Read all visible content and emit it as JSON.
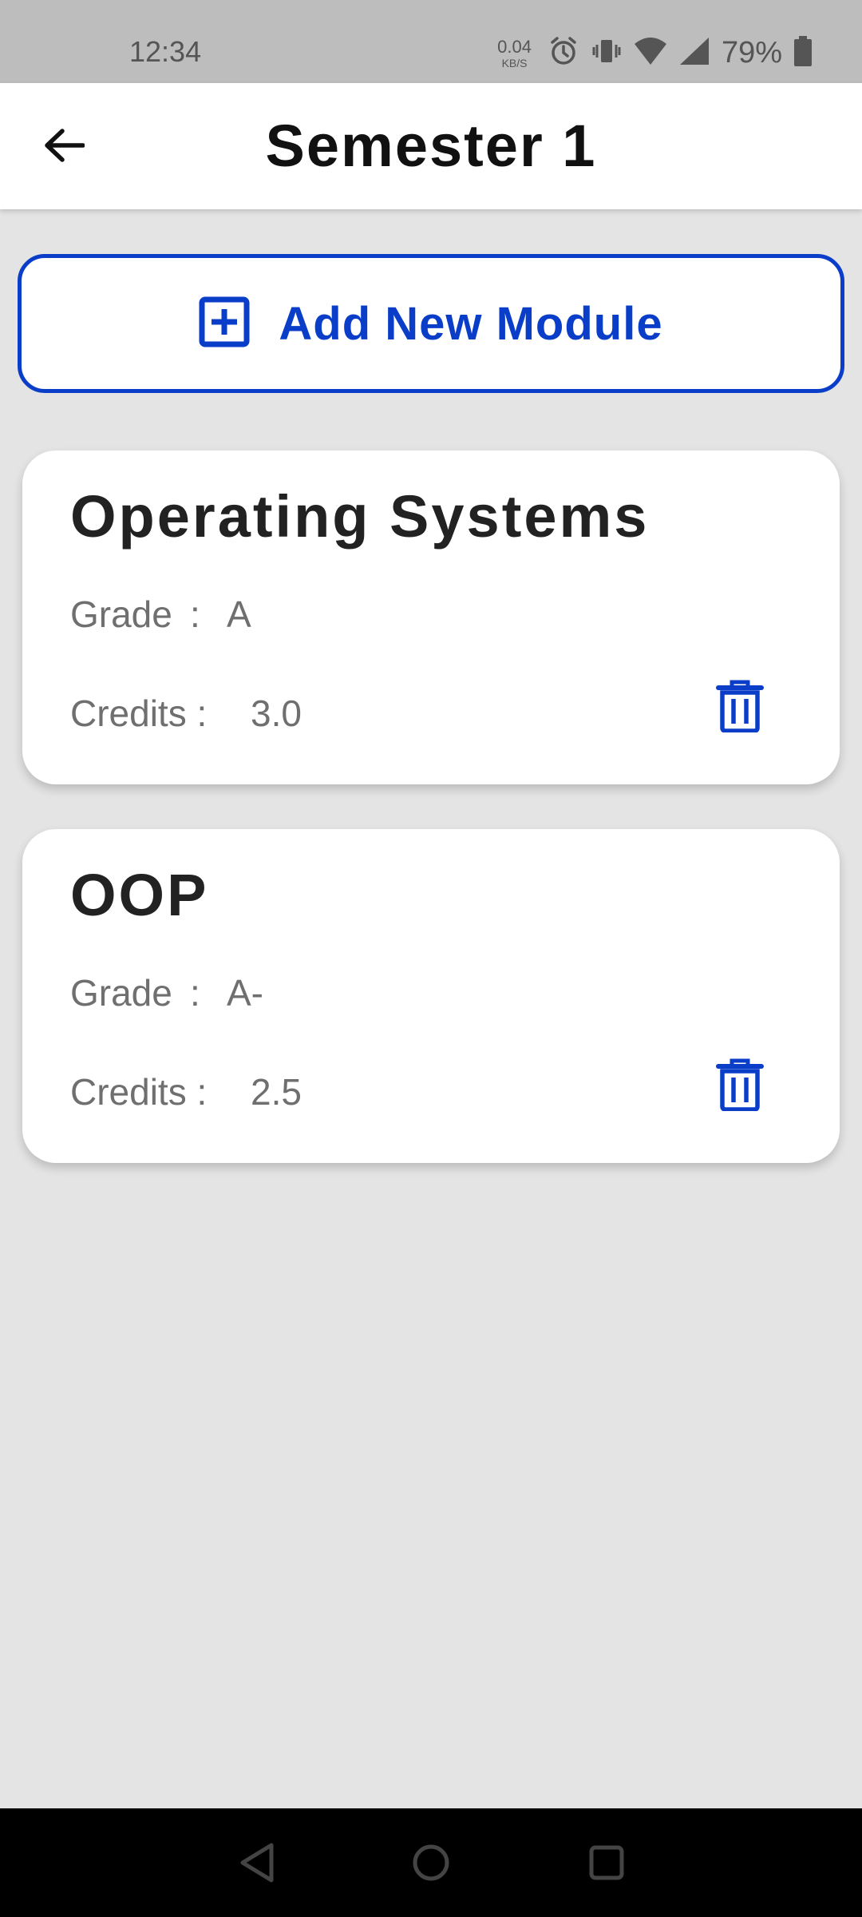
{
  "status_bar": {
    "time": "12:34",
    "net_speed_value": "0.04",
    "net_speed_unit": "KB/S",
    "battery": "79%",
    "icons": [
      "alarm-icon",
      "vibrate-icon",
      "wifi-icon",
      "signal-icon",
      "battery-icon"
    ]
  },
  "header": {
    "title": "Semester 1",
    "back_icon": "arrow-back-icon"
  },
  "add_button": {
    "label": "Add New Module",
    "icon": "add-box-icon"
  },
  "modules": [
    {
      "name": "Operating Systems",
      "grade_label": "Grade",
      "separator": ":",
      "grade": "A",
      "credits_label": "Credits :",
      "credits": "3.0"
    },
    {
      "name": "OOP",
      "grade_label": "Grade",
      "separator": ":",
      "grade": "A-",
      "credits_label": "Credits :",
      "credits": "2.5"
    }
  ],
  "colors": {
    "accent": "#0a3ec9",
    "background": "#e4e4e4",
    "status_bar": "#bdbdbd",
    "nav_bar": "#000000"
  }
}
